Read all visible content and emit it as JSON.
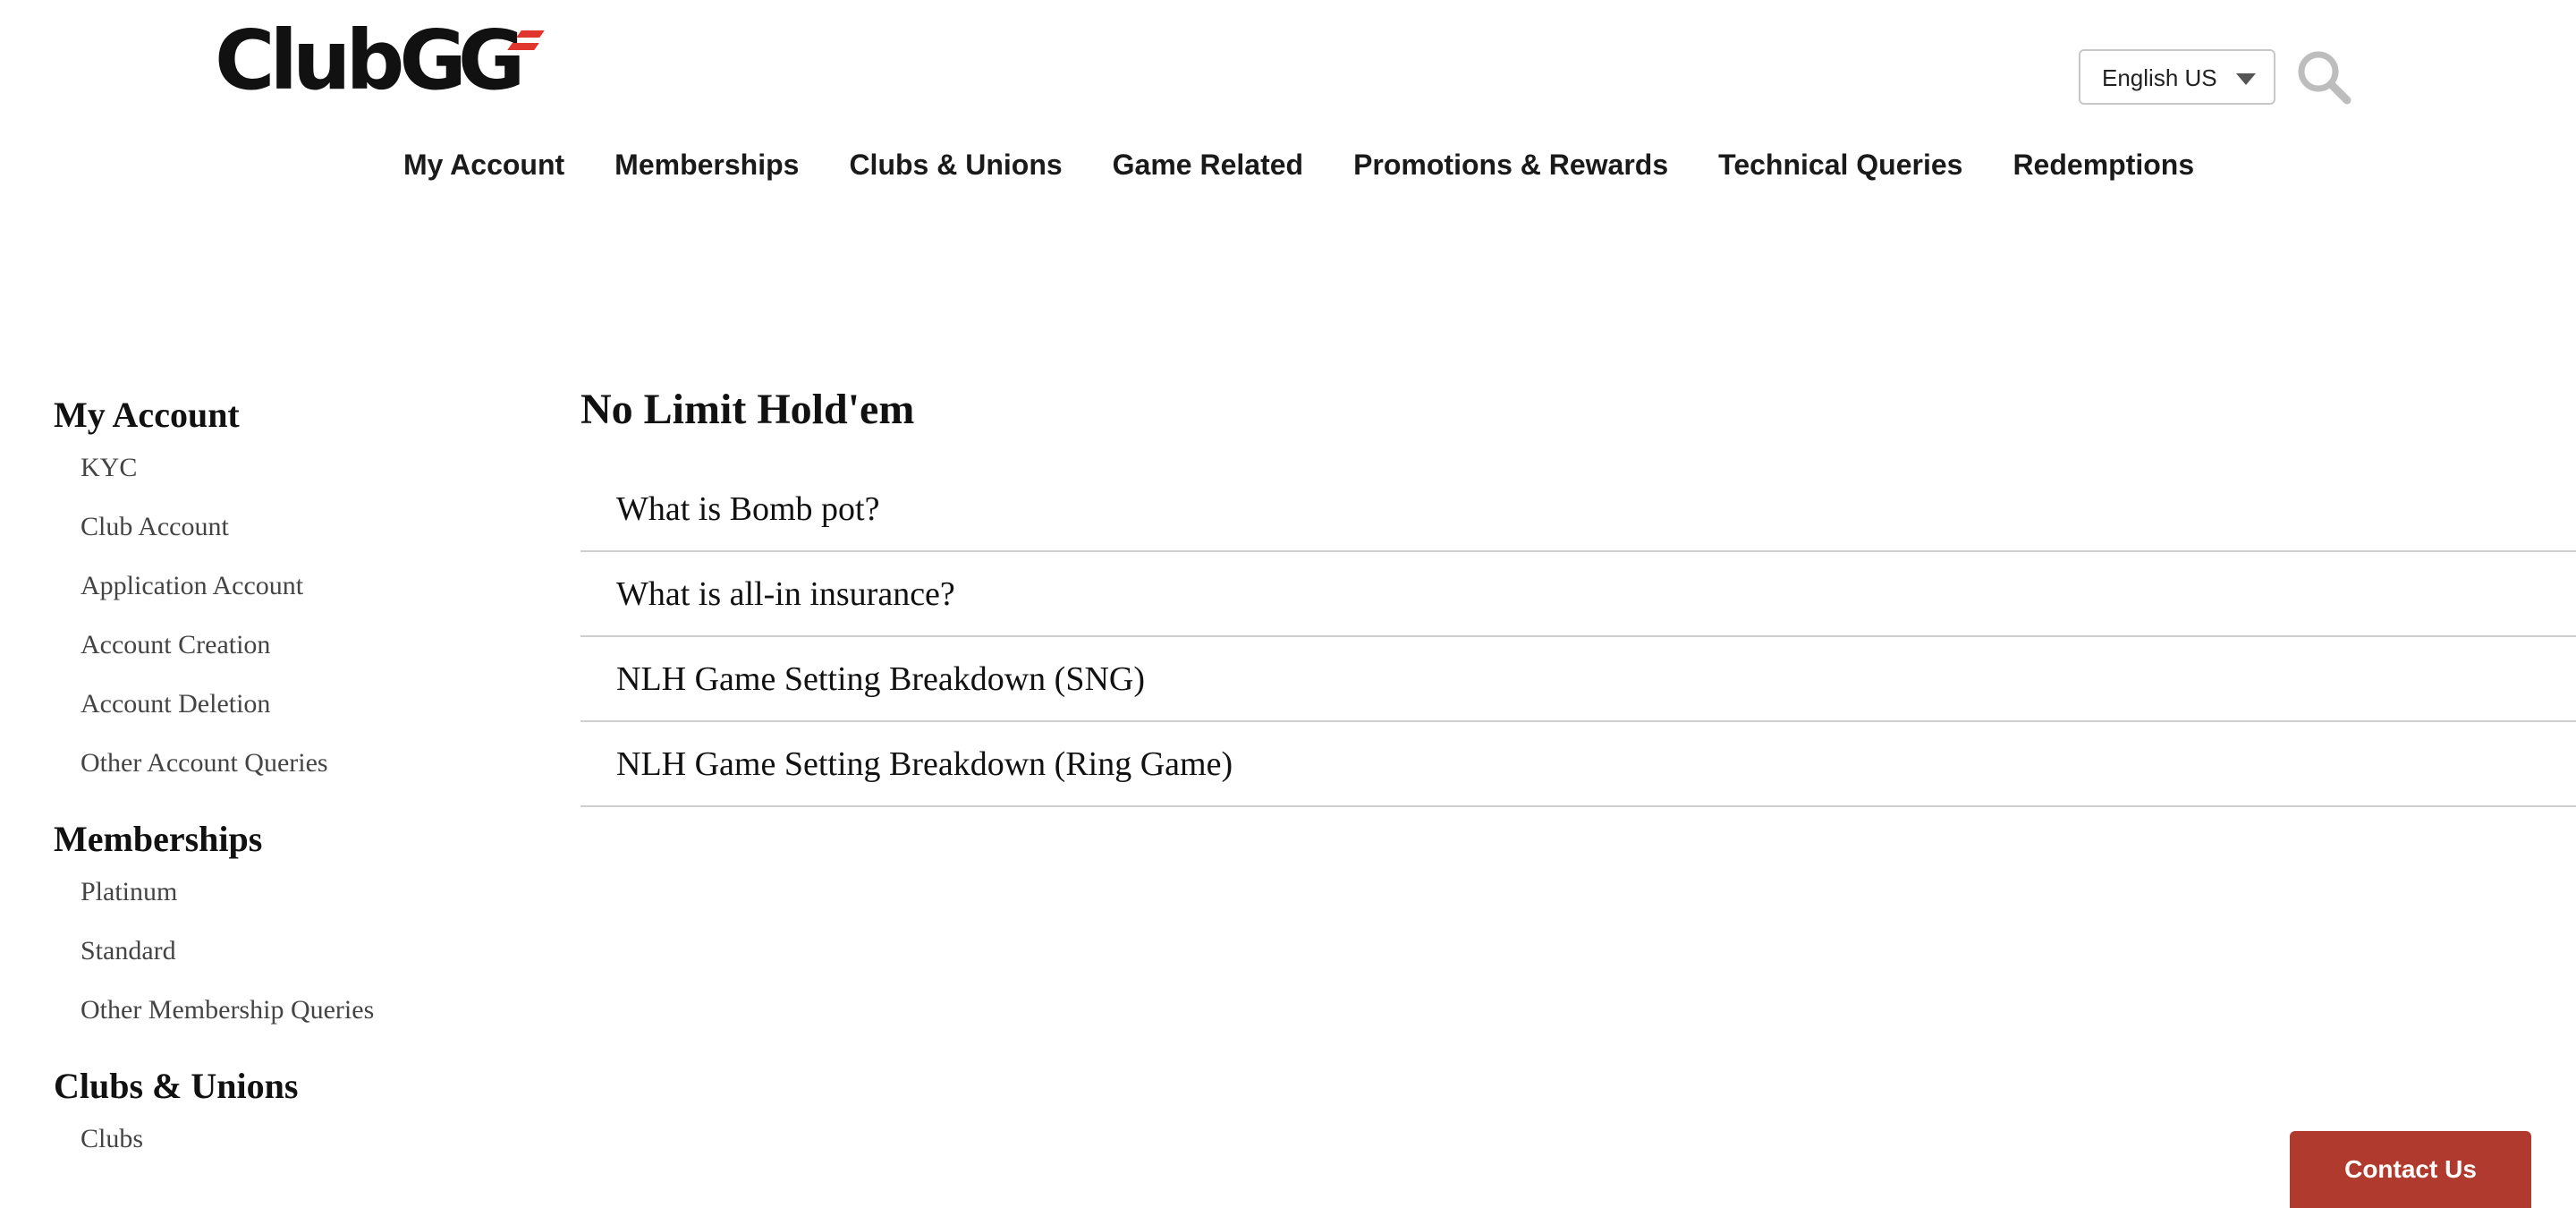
{
  "brand": {
    "logo_text_club": "Club",
    "logo_text_gg": "GG",
    "accent_color": "#e0362e"
  },
  "header": {
    "language": {
      "selected": "English US"
    },
    "search_icon": "search-icon"
  },
  "nav": {
    "items": [
      {
        "label": "My Account"
      },
      {
        "label": "Memberships"
      },
      {
        "label": "Clubs & Unions"
      },
      {
        "label": "Game Related"
      },
      {
        "label": "Promotions & Rewards"
      },
      {
        "label": "Technical Queries"
      },
      {
        "label": "Redemptions"
      }
    ]
  },
  "sidebar": {
    "sections": [
      {
        "title": "My Account",
        "items": [
          "KYC",
          "Club Account",
          "Application Account",
          "Account Creation",
          "Account Deletion",
          "Other Account Queries"
        ]
      },
      {
        "title": "Memberships",
        "items": [
          "Platinum",
          "Standard",
          "Other Membership Queries"
        ]
      },
      {
        "title": "Clubs & Unions",
        "items": [
          "Clubs"
        ]
      }
    ]
  },
  "content": {
    "title": "No Limit Hold'em",
    "faqs": [
      "What is Bomb pot?",
      "What is all-in insurance?",
      "NLH Game Setting Breakdown (SNG)",
      "NLH Game Setting Breakdown (Ring Game)"
    ]
  },
  "contact": {
    "label": "Contact Us",
    "color": "#b03a2e"
  }
}
